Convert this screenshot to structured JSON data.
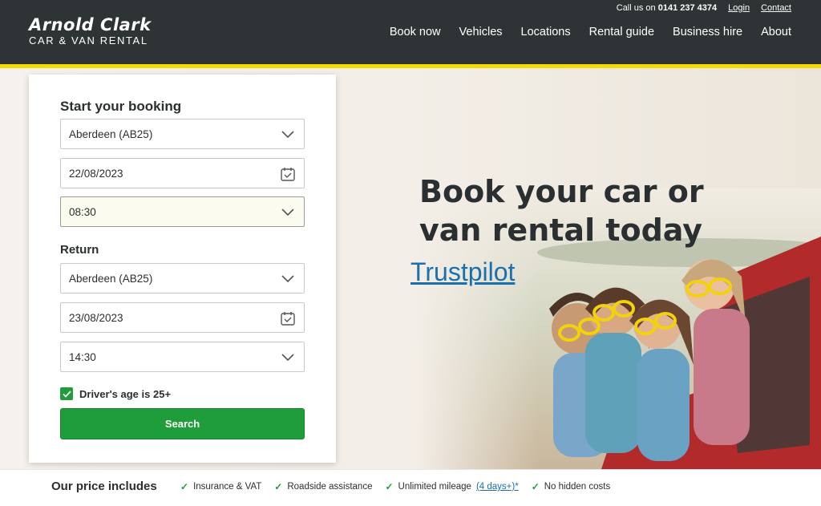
{
  "header": {
    "logo_main": "Arnold Clark",
    "logo_sub": "CAR & VAN RENTAL",
    "call_prefix": "Call us on",
    "phone": "0141 237 4374",
    "login": "Login",
    "contact": "Contact",
    "nav": [
      "Book now",
      "Vehicles",
      "Locations",
      "Rental guide",
      "Business hire",
      "About"
    ]
  },
  "booking": {
    "title": "Start your booking",
    "pickup_location": "Aberdeen (AB25)",
    "pickup_date": "22/08/2023",
    "pickup_time": "08:30",
    "return_title": "Return",
    "return_location": "Aberdeen (AB25)",
    "return_date": "23/08/2023",
    "return_time": "14:30",
    "age_label": "Driver's age is 25+",
    "search_label": "Search"
  },
  "hero": {
    "headline_line1": "Book your car or",
    "headline_line2": "van rental today",
    "trust_link": "Trustpilot"
  },
  "price": {
    "title": "Our price includes",
    "item1": "Insurance & VAT",
    "item2": "Roadside assistance",
    "item3": "Unlimited mileage",
    "item3_link": "(4 days+)*",
    "item4": "No hidden costs"
  },
  "colors": {
    "header_bg": "#2e3435",
    "accent_yellow": "#f4dc00",
    "button_green": "#1f9d3a",
    "link_blue": "#1b6fae"
  }
}
